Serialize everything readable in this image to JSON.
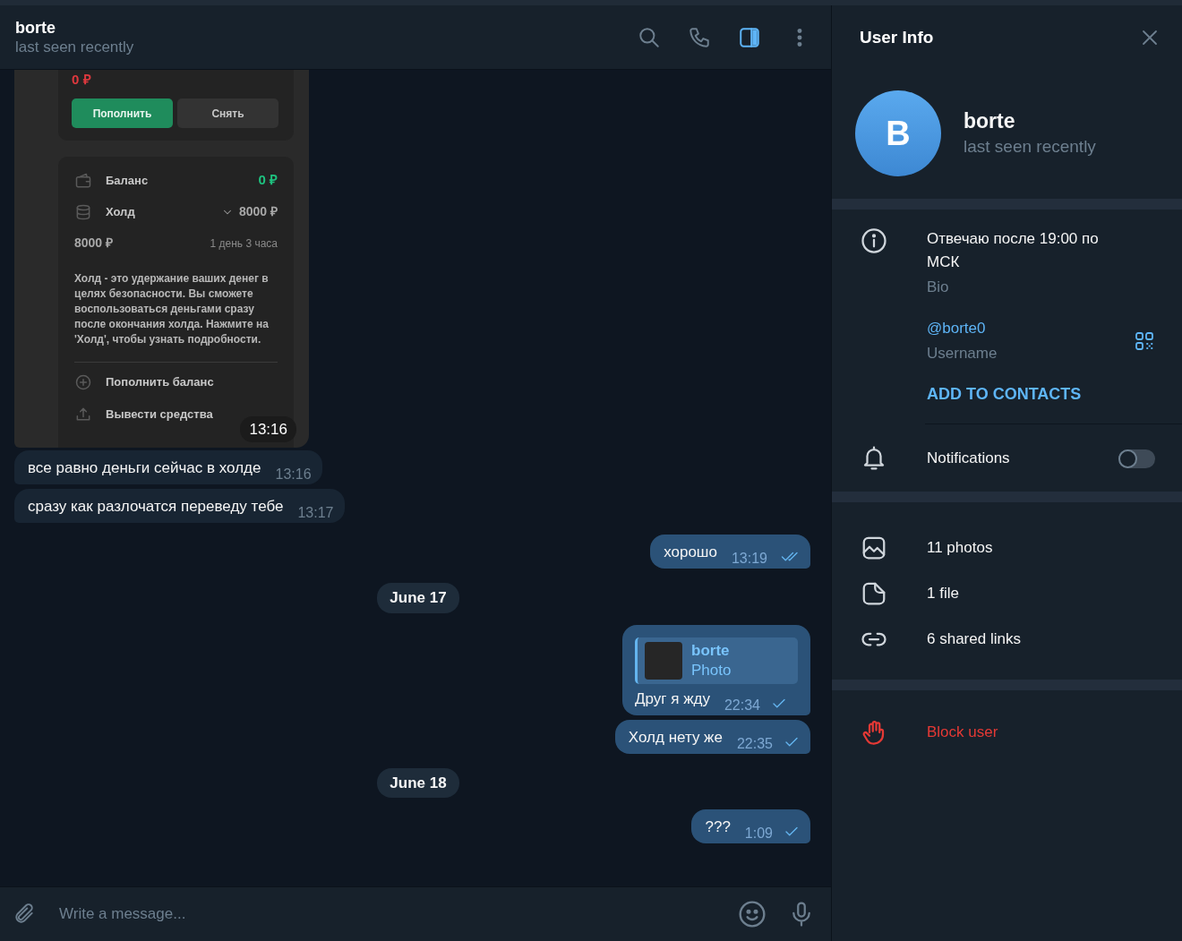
{
  "header": {
    "name": "borte",
    "status": "last seen recently",
    "panel_open": true
  },
  "messages": [
    {
      "kind": "photo",
      "outgoing": false,
      "time": "13:16",
      "photo": {
        "amount": "0 ₽",
        "buttons": [
          {
            "label": "Пополнить",
            "primary": true
          },
          {
            "label": "Снять",
            "primary": false
          }
        ],
        "rows": [
          {
            "kind": "balance",
            "label": "Баланс",
            "value": "0 ₽"
          },
          {
            "kind": "hold",
            "label": "Холд",
            "value": "8000 ₽"
          }
        ],
        "hold_amount": "8000 ₽",
        "hold_time": "1 день 3 часа",
        "note": "Холд - это удержание ваших денег в целях безопасности. Вы сможете воспользоваться деньгами сразу после окончания холда. Нажмите на 'Холд', чтобы узнать подробности.",
        "actions": [
          {
            "kind": "topup",
            "label": "Пополнить баланс"
          },
          {
            "kind": "withdraw",
            "label": "Вывести средства"
          }
        ]
      }
    },
    {
      "kind": "text",
      "outgoing": false,
      "text": "все равно деньги сейчас в холде",
      "time": "13:16"
    },
    {
      "kind": "text",
      "outgoing": false,
      "text": "сразу как разлочатся переведу тебе",
      "time": "13:17"
    },
    {
      "kind": "text",
      "outgoing": true,
      "text": "хорошо",
      "time": "13:19",
      "read": true
    },
    {
      "kind": "date",
      "text": "June 17"
    },
    {
      "kind": "reply",
      "outgoing": true,
      "reply_name": "borte",
      "reply_text": "Photo",
      "text": "Друг я жду",
      "time": "22:34",
      "read": false
    },
    {
      "kind": "text",
      "outgoing": true,
      "text": "Холд нету же",
      "time": "22:35",
      "read": false
    },
    {
      "kind": "date",
      "text": "June 18"
    },
    {
      "kind": "text",
      "outgoing": true,
      "text": "???",
      "time": "1:09",
      "read": false
    }
  ],
  "composer": {
    "placeholder": "Write a message..."
  },
  "info": {
    "title": "User Info",
    "avatar_letter": "B",
    "name": "borte",
    "status": "last seen recently",
    "bio": "Отвечаю после 19:00 по МСК",
    "bio_label": "Bio",
    "username": "@borte0",
    "username_label": "Username",
    "add_contact": "ADD TO CONTACTS",
    "notifications": {
      "label": "Notifications",
      "on": false
    },
    "media": [
      {
        "kind": "photos",
        "label": "11 photos"
      },
      {
        "kind": "files",
        "label": "1 file"
      },
      {
        "kind": "links",
        "label": "6 shared links"
      }
    ],
    "block": "Block user"
  }
}
